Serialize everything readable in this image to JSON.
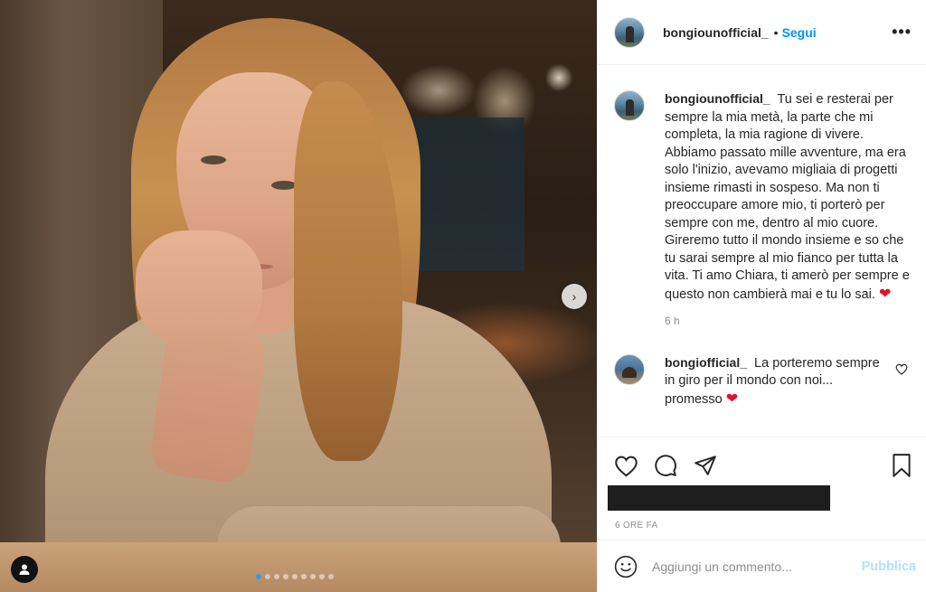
{
  "header": {
    "username": "bongiounofficial_",
    "follow_dot": "•",
    "follow_label": "Segui",
    "more_label": "•••"
  },
  "caption": {
    "username": "bongiounofficial_",
    "text": "Tu sei e resterai per sempre la mia metà, la parte che mi completa, la mia ragione di vivere. Abbiamo passato mille avventure, ma era solo l'inizio, avevamo migliaia di progetti insieme rimasti in sospeso. Ma non ti preoccupare amore mio, ti porterò per sempre con me, dentro al mio cuore. Gireremo tutto il mondo insieme e so che tu sarai sempre al mio fianco per tutta la vita. Ti amo Chiara, ti amerò per sempre e questo non cambierà mai e tu lo sai.",
    "emoji": "❤",
    "time": "6 h"
  },
  "reply": {
    "username": "bongiofficial_",
    "text": "La porteremo sempre in giro per il mondo con noi... promesso",
    "emoji": "❤"
  },
  "post_time": "6 ORE FA",
  "composer": {
    "placeholder": "Aggiungi un commento...",
    "publish_label": "Pubblica"
  },
  "carousel": {
    "slides": 9,
    "current": 1,
    "next_glyph": "›"
  },
  "icons": [
    "heart-icon",
    "comment-icon",
    "share-icon",
    "bookmark-icon",
    "emoji-icon",
    "user-tag-icon",
    "chevron-right-icon"
  ],
  "colors": {
    "accent": "#0095f6",
    "publish_disabled": "#b2dffc",
    "heart": "#e0102c"
  }
}
